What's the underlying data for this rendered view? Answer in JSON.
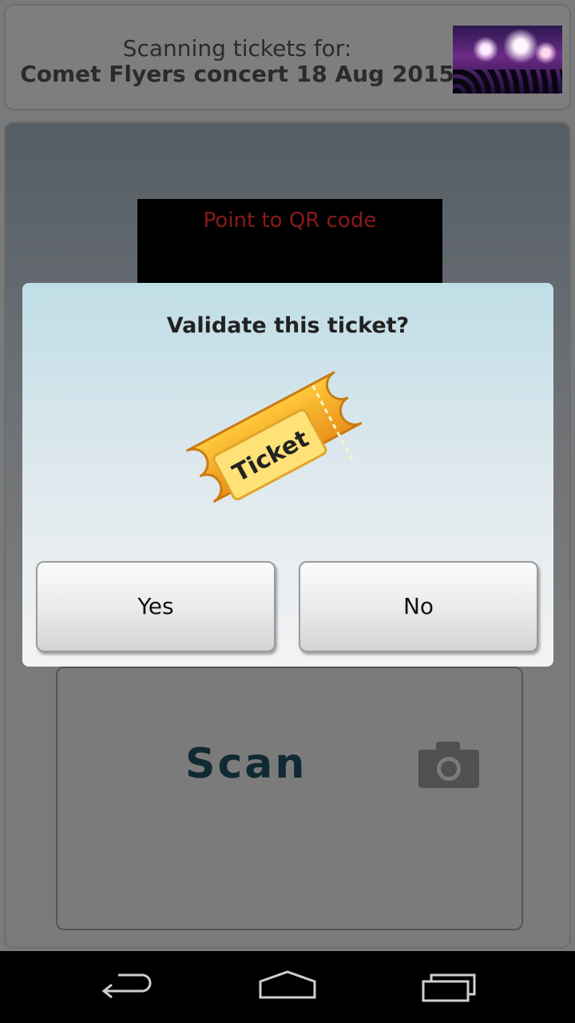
{
  "header": {
    "line1": "Scanning tickets for:",
    "line2": "Comet Flyers concert 18 Aug 2015",
    "thumbnail": "concert-crowd-image"
  },
  "scanner": {
    "hint": "Point to QR code"
  },
  "scan_button": {
    "label": "Scan",
    "icon": "camera-icon"
  },
  "dialog": {
    "title": "Validate this ticket?",
    "image_text": "Ticket",
    "yes_label": "Yes",
    "no_label": "No"
  },
  "navbar": {
    "items": [
      "back-icon",
      "home-icon",
      "recent-apps-icon"
    ]
  },
  "colors": {
    "ticket_orange": "#f5a623",
    "scan_text": "#0f2a33",
    "hint_red": "#8a1a1a"
  }
}
